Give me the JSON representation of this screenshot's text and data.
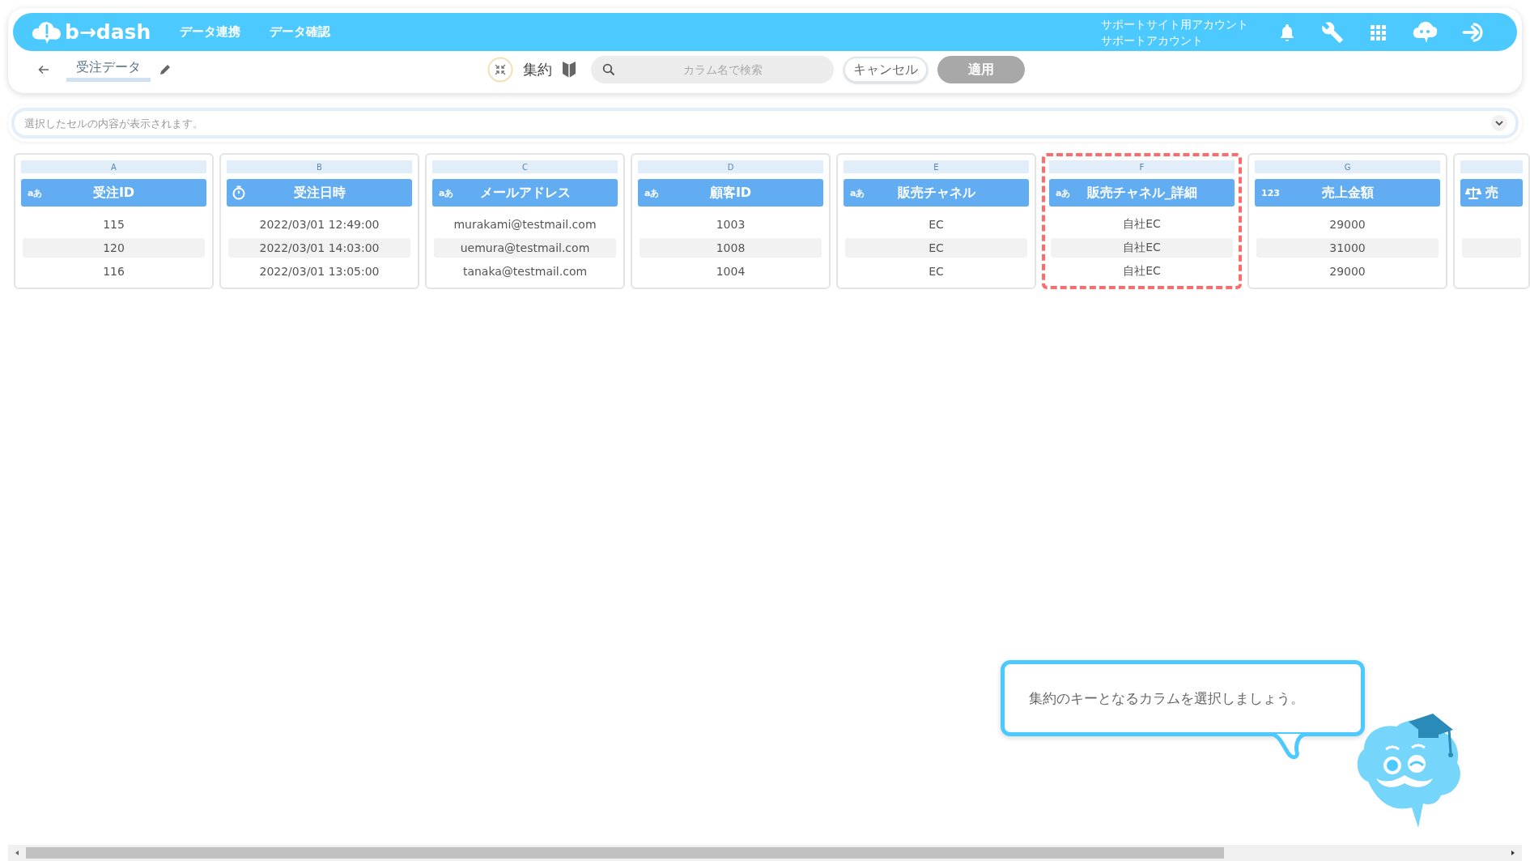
{
  "header": {
    "logo": "b→dash",
    "nav": [
      {
        "label": "データ連携"
      },
      {
        "label": "データ確認"
      }
    ],
    "account": {
      "site": "サポートサイト用アカウント",
      "name": "サポートアカウント"
    }
  },
  "toolbar": {
    "title": "受注データ",
    "mode": "集約",
    "search": {
      "placeholder": "カラム名で検索"
    },
    "cancel": "キャンセル",
    "apply": {
      "label": "適用",
      "disabled": true
    }
  },
  "cell_viewer": {
    "placeholder": "選択したセルの内容が表示されます。"
  },
  "columns": [
    {
      "letter": "A",
      "kind": "text",
      "type_mark": "aあ",
      "name": "受注ID",
      "highlighted": false,
      "cells": [
        "115",
        "120",
        "116"
      ]
    },
    {
      "letter": "B",
      "kind": "datetime",
      "name": "受注日時",
      "highlighted": false,
      "cells": [
        "2022/03/01 12:49:00",
        "2022/03/01 14:03:00",
        "2022/03/01 13:05:00"
      ]
    },
    {
      "letter": "C",
      "kind": "text",
      "type_mark": "aあ",
      "name": "メールアドレス",
      "highlighted": false,
      "cells": [
        "murakami@testmail.com",
        "uemura@testmail.com",
        "tanaka@testmail.com"
      ]
    },
    {
      "letter": "D",
      "kind": "text",
      "type_mark": "aあ",
      "name": "顧客ID",
      "highlighted": false,
      "cells": [
        "1003",
        "1008",
        "1004"
      ]
    },
    {
      "letter": "E",
      "kind": "text",
      "type_mark": "aあ",
      "name": "販売チャネル",
      "highlighted": false,
      "cells": [
        "EC",
        "EC",
        "EC"
      ]
    },
    {
      "letter": "F",
      "kind": "text",
      "type_mark": "aあ",
      "name": "販売チャネル_詳細",
      "highlighted": true,
      "cells": [
        "自社EC",
        "自社EC",
        "自社EC"
      ]
    },
    {
      "letter": "G",
      "kind": "number",
      "type_mark": "123",
      "name": "売上金額",
      "highlighted": false,
      "cells": [
        "29000",
        "31000",
        "29000"
      ]
    },
    {
      "kind": "formula",
      "name": "売",
      "highlighted": false
    }
  ],
  "hint": {
    "text": "集約のキーとなるカラムを選択しましょう。"
  }
}
